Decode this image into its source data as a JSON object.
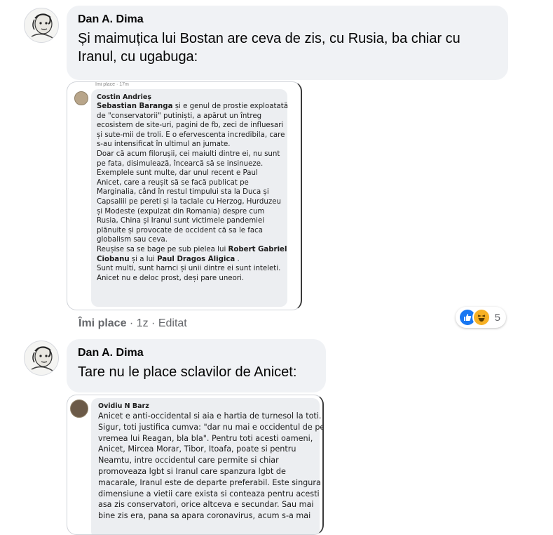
{
  "comments": [
    {
      "author": "Dan A. Dima",
      "text_line1": "Și maimuțica lui Bostan are ceva de zis, cu Rusia, ba chiar cu",
      "text_line2": "Iranul, cu ugabuga:"
    },
    {
      "author": "Dan A. Dima",
      "text": "Tare nu le place sclavilor de Anicet:"
    }
  ],
  "screenshot1": {
    "top_cut": "Îmi place · 17m",
    "author": "Costin Andrieș",
    "lines": [
      {
        "bold": "Sebastian Baranga",
        "text": " și e genul de prostie exploatată"
      },
      {
        "text": "de \"conservatorii\" putiniști, a apărut un întreg"
      },
      {
        "text": "ecosistem de site-uri, pagini de fb, zeci de influesari"
      },
      {
        "text": "și sute-mii de troli. E o efervescenta incredibila, care"
      },
      {
        "text": "s-au intensificat în ultimul an jumate."
      },
      {
        "text": "Doar că acum filorușii, cei maiulti dintre ei, nu sunt"
      },
      {
        "text": "pe fata, disimulează, încearcă să se insinueze."
      },
      {
        "text": "Exemplele sunt multe, dar unul recent e Paul"
      },
      {
        "text": "Anicet, care a reușit să se facă publicat pe"
      },
      {
        "text": "Marginalia, când în restul timpului sta la Duca și"
      },
      {
        "text": "Capsaliii pe pereti și la taclale cu Herzog, Hurduzeu"
      },
      {
        "text": "și Modeste (expulzat din Romania) despre cum"
      },
      {
        "text": "Rusia, China și Iranul sunt victimele pandemiei"
      },
      {
        "text": "plănuite și provocate de occident că sa le faca"
      },
      {
        "text": "globalism sau ceva."
      },
      {
        "text": "Reușise sa se bage pe sub pielea lui ",
        "bold_after": "Robert Gabriel"
      },
      {
        "bold": "Ciobanu",
        "text": " și a lui ",
        "bold_after": "Paul Dragos Aligica",
        "text_after": " ."
      },
      {
        "text": "Sunt multi, sunt harnci și unii dintre ei sunt inteleti."
      },
      {
        "text": "Anicet nu e deloc prost, deși pare uneori."
      }
    ]
  },
  "actions": {
    "like": "Îmi place",
    "sep1": " · ",
    "time": "1z",
    "sep2": " · ",
    "edited": "Editat"
  },
  "reactions": {
    "like_icon": "thumbs-up-icon",
    "haha_icon": "laughing-face-icon",
    "count": "5"
  },
  "screenshot2": {
    "author": "Ovidiu N Barz",
    "lines": [
      "Anicet e anti-occidental si aia e hartia de turnesol la toti.",
      "Sigur, toti justifica cumva: \"dar nu mai e occidentul de pe",
      "vremea lui Reagan, bla bla\". Pentru toti acesti oameni,",
      "Anicet, Mircea Morar, Tibor, Itoafa, poate si pentru",
      "Neamtu, intre occidentul care permite si chiar",
      "promoveaza lgbt si Iranul care spanzura lgbt de",
      "macarale, Iranul este de departe preferabil. Este singura",
      "dimensiune a vietii care exista si conteaza pentru acesti",
      "asa zis conservatori, orice altceva e secundar. Sau mai",
      "bine zis era, pana sa apara coronavirus, acum s-a mai"
    ]
  }
}
